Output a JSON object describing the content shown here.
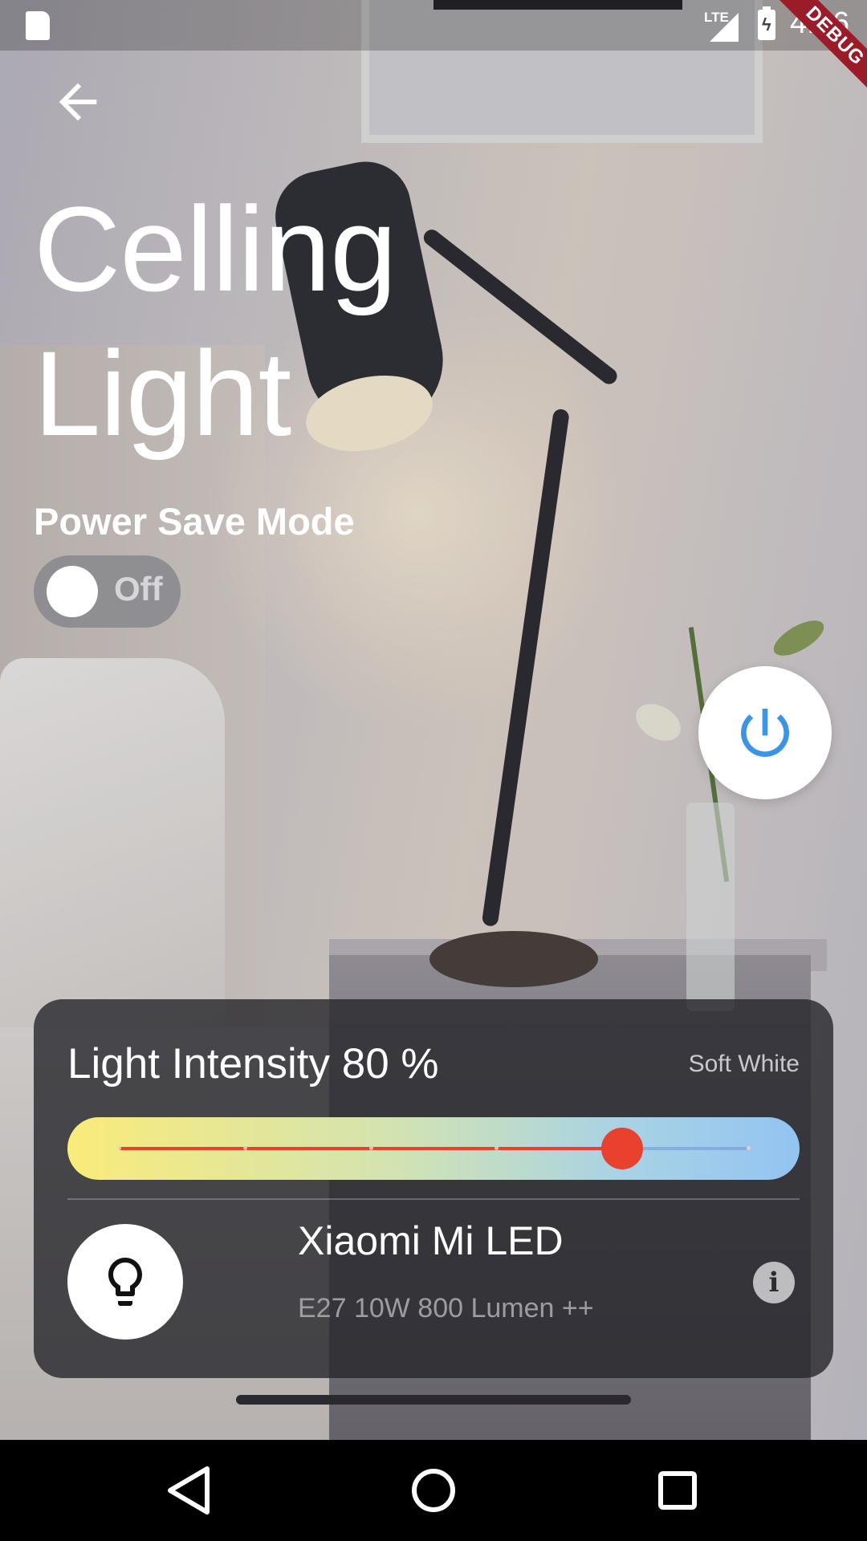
{
  "status_bar": {
    "network": "LTE",
    "time": "4:46",
    "debug_banner": "DEBUG"
  },
  "header": {
    "back_icon": "arrow-back-icon",
    "title": "Celling Light"
  },
  "power_save": {
    "label": "Power Save Mode",
    "toggle_text": "Off",
    "enabled": false
  },
  "power_button": {
    "icon": "power-icon",
    "color": "#3c94e6"
  },
  "light_card": {
    "intensity_label": "Light Intensity 80 %",
    "intensity_value": 80,
    "tone_label": "Soft White",
    "slider": {
      "value": 80,
      "min": 0,
      "max": 100,
      "divisions": 5,
      "active_color": "#e8412d"
    },
    "device": {
      "icon": "lightbulb-icon",
      "name": "Xiaomi Mi LED",
      "spec": "E27 10W 800 Lumen ++",
      "info_icon": "info-icon"
    }
  },
  "nav_bar": {
    "back_icon": "nav-back-icon",
    "home_icon": "nav-home-icon",
    "recents_icon": "nav-recents-icon"
  }
}
